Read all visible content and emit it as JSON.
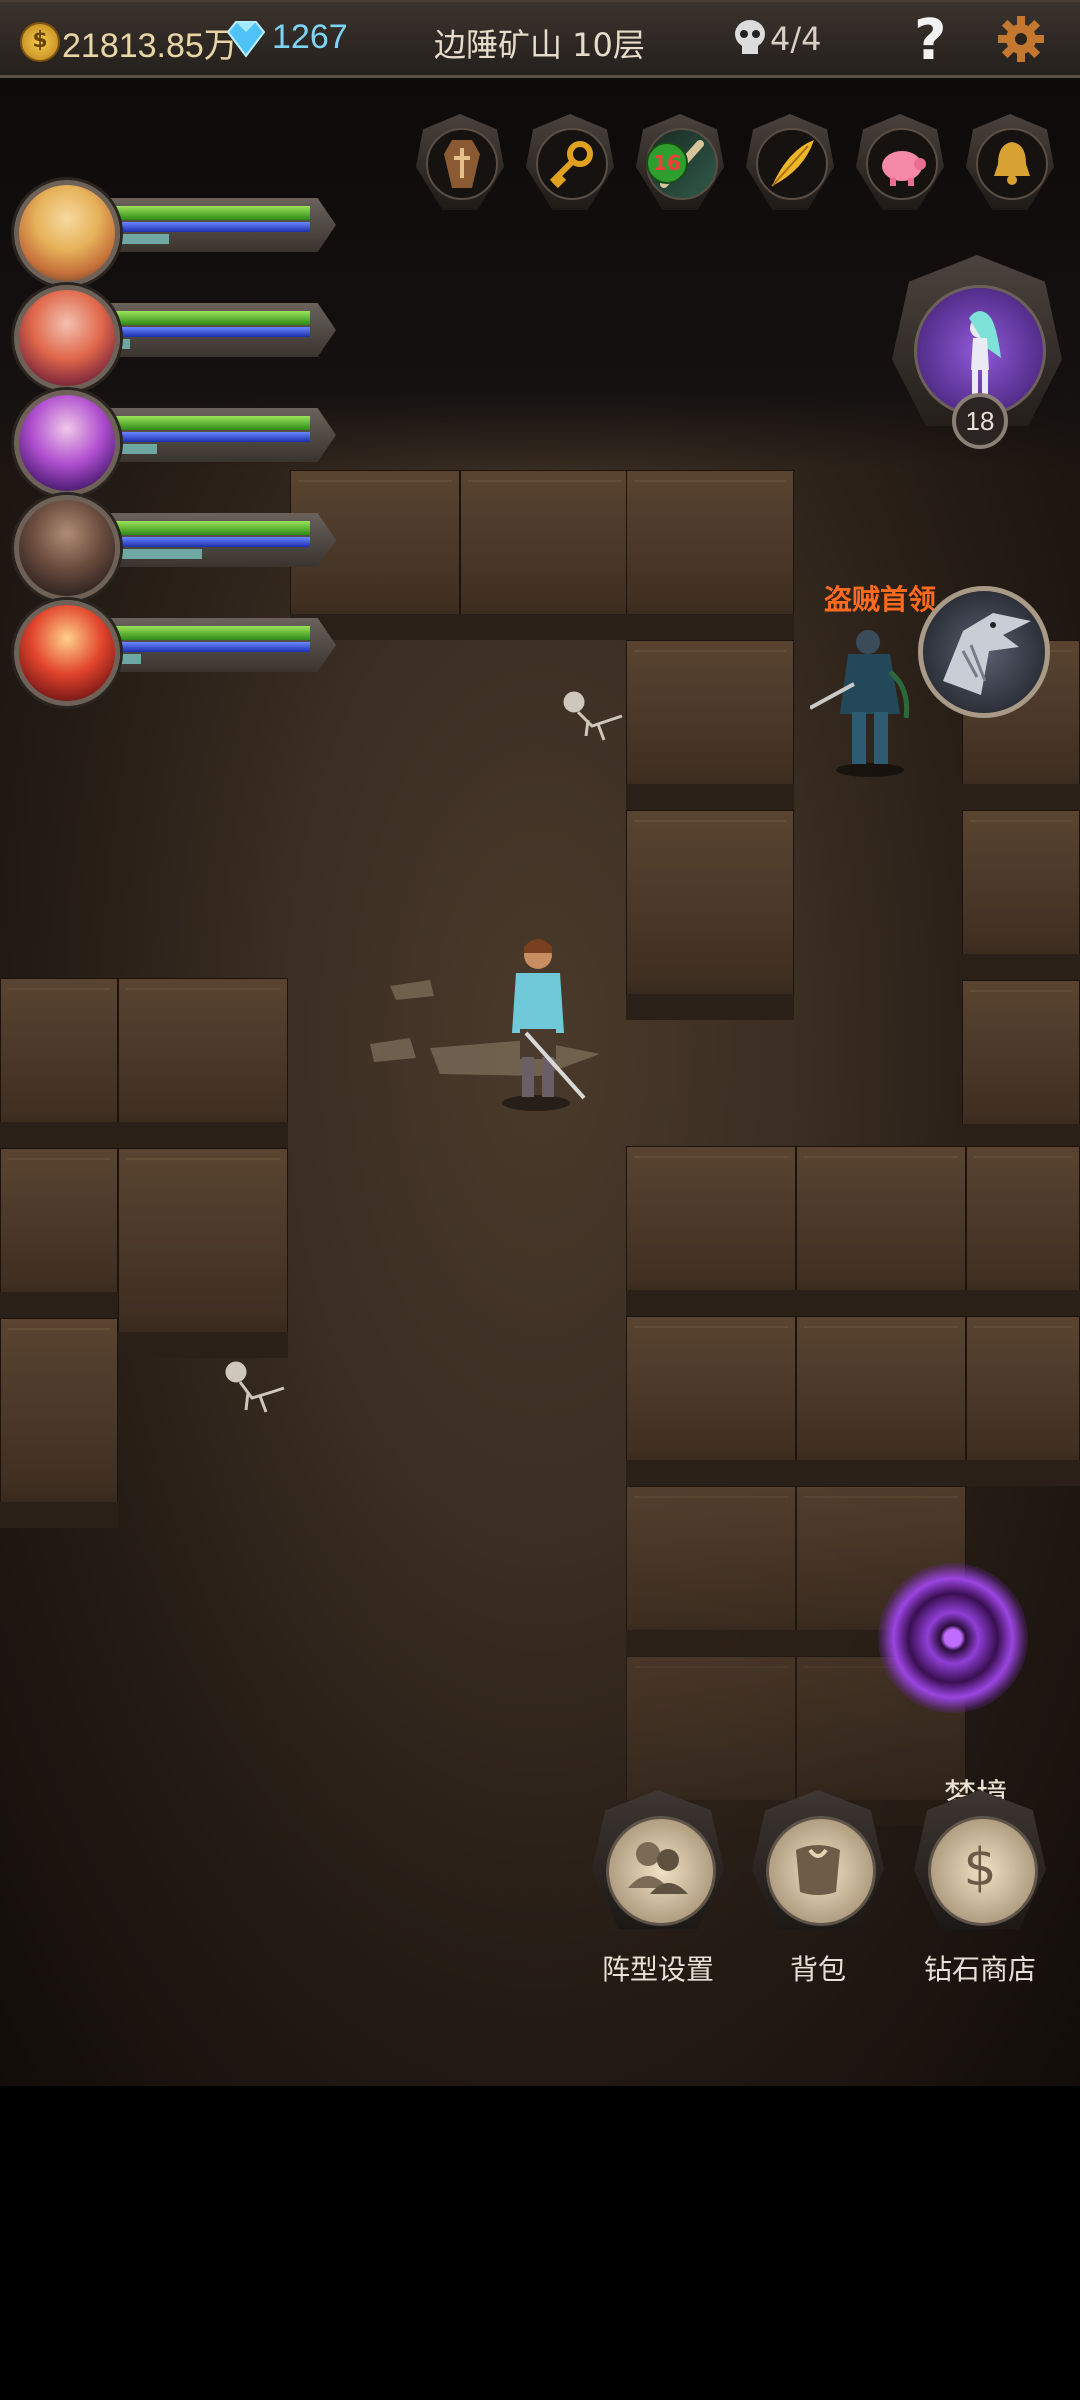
{
  "hud": {
    "gold": "21813.85万",
    "diamonds": "1267",
    "floor": "边陲矿山 10层",
    "kills": "4/4",
    "help": "?"
  },
  "items_bar": {
    "badge": "16",
    "items": [
      {
        "icon": "coffin-icon"
      },
      {
        "icon": "key-icon"
      },
      {
        "icon": "flute-icon"
      },
      {
        "icon": "feather-icon"
      },
      {
        "icon": "piggy-bank-icon"
      },
      {
        "icon": "bell-icon"
      }
    ]
  },
  "party": [
    {
      "name": "hero-1",
      "hp": 1.0,
      "mp": 1.0,
      "exp": 0.28
    },
    {
      "name": "hero-2",
      "hp": 1.0,
      "mp": 1.0,
      "exp": 0.08
    },
    {
      "name": "hero-3",
      "hp": 1.0,
      "mp": 1.0,
      "exp": 0.22
    },
    {
      "name": "hero-4",
      "hp": 1.0,
      "mp": 1.0,
      "exp": 0.45
    },
    {
      "name": "hero-5",
      "hp": 1.0,
      "mp": 1.0,
      "exp": 0.14
    }
  ],
  "companion": {
    "level": "18"
  },
  "boss": {
    "label": "盗贼首领"
  },
  "portal": {
    "label": "梦境"
  },
  "buttons": {
    "formation": "阵型设置",
    "bag": "背包",
    "shop": "钻石商店",
    "shop_symbol": "$"
  },
  "colors": {
    "hp": "#4caf28",
    "mp": "#2a48d8",
    "exp": "#6fa7a3",
    "boss_label": "#ff6a1e",
    "diamonds": "#7fd3f5"
  }
}
